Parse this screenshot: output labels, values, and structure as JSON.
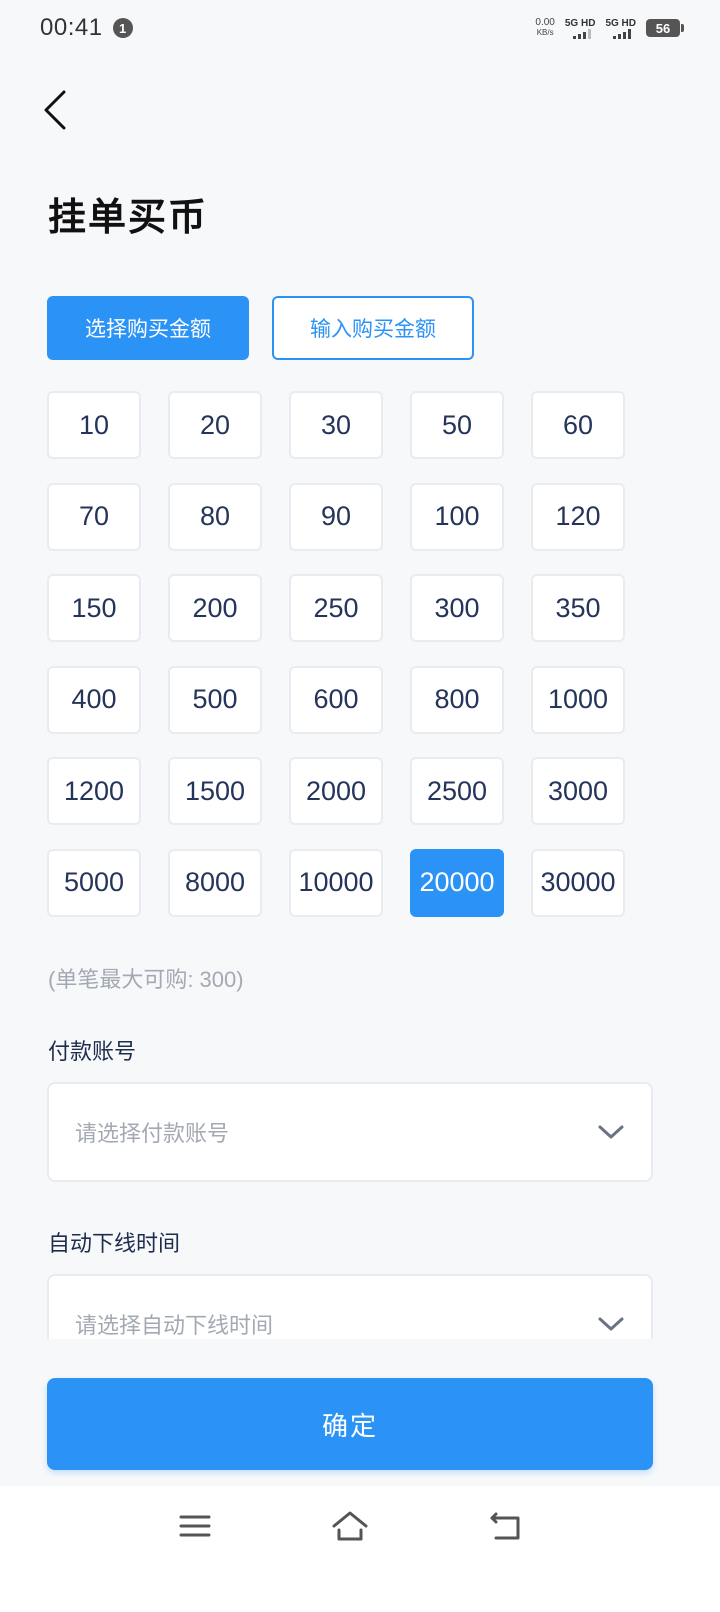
{
  "status_bar": {
    "time": "00:41",
    "notification_count": "1",
    "net_speed": "0.00",
    "net_speed_unit": "KB/s",
    "sim1_label": "5G HD",
    "sim2_label": "5G HD",
    "battery": "56"
  },
  "page": {
    "title": "挂单买币"
  },
  "mode_tabs": {
    "select_label": "选择购买金额",
    "input_label": "输入购买金额",
    "active": "select"
  },
  "amounts": [
    "10",
    "20",
    "30",
    "50",
    "60",
    "70",
    "80",
    "90",
    "100",
    "120",
    "150",
    "200",
    "250",
    "300",
    "350",
    "400",
    "500",
    "600",
    "800",
    "1000",
    "1200",
    "1500",
    "2000",
    "2500",
    "3000",
    "5000",
    "8000",
    "10000",
    "20000",
    "30000"
  ],
  "selected_amount": "20000",
  "limit_hint": "(单笔最大可购: 300)",
  "payment_account": {
    "label": "付款账号",
    "placeholder": "请选择付款账号"
  },
  "auto_offline": {
    "label": "自动下线时间",
    "placeholder": "请选择自动下线时间"
  },
  "confirm_label": "确定",
  "colors": {
    "accent": "#2b93f6",
    "text_primary": "#1f2d4d",
    "placeholder": "#a3a9b3",
    "background": "#f7f8fa"
  }
}
